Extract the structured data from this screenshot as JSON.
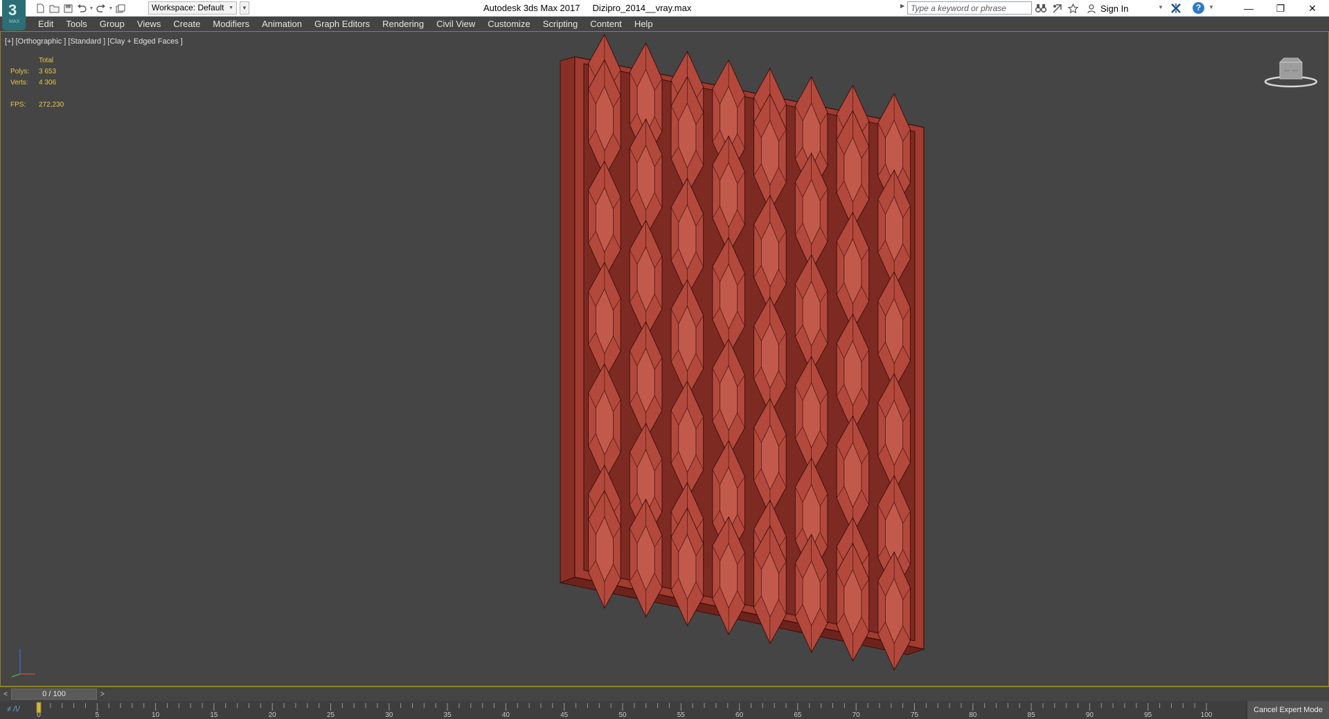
{
  "app": {
    "logo_text": "3",
    "logo_sub": "MAX",
    "title": "Autodesk 3ds Max 2017     Dizipro_2014__vray.max"
  },
  "quick_access": {
    "workspace_label": "Workspace: Default"
  },
  "search": {
    "placeholder": "Type a keyword or phrase"
  },
  "account": {
    "sign_in": "Sign In"
  },
  "window_controls": {
    "minimize": "—",
    "restore": "❐",
    "close": "✕"
  },
  "menu": {
    "items": [
      "Edit",
      "Tools",
      "Group",
      "Views",
      "Create",
      "Modifiers",
      "Animation",
      "Graph Editors",
      "Rendering",
      "Civil View",
      "Customize",
      "Scripting",
      "Content",
      "Help"
    ]
  },
  "viewport": {
    "label": "[+] [Orthographic ] [Standard ] [Clay + Edged Faces ]",
    "stats": {
      "header": "Total",
      "polys_label": "Polys:",
      "polys_value": "3 653",
      "verts_label": "Verts:",
      "verts_value": "4 306",
      "fps_label": "FPS:",
      "fps_value": "272,230"
    },
    "model": {
      "frame_color": "#a23b30",
      "tile_color": "#b2493c",
      "edge_color": "#3a0d0a",
      "columns": 8,
      "rows": 5
    }
  },
  "timeline": {
    "frame_display": "0 / 100",
    "left_arrow": "<",
    "right_arrow": ">",
    "current_frame": 0,
    "start": 0,
    "end": 100,
    "tick_labels": [
      "0",
      "5",
      "10",
      "15",
      "20",
      "25",
      "30",
      "35",
      "40",
      "45",
      "50",
      "55",
      "60",
      "65",
      "70",
      "75",
      "80",
      "85",
      "90",
      "95",
      "100"
    ]
  },
  "status": {
    "cancel_expert": "Cancel Expert Mode",
    "track_icon": "≠ /\\/"
  },
  "icons": {
    "new": "new-file-icon",
    "open": "open-folder-icon",
    "save": "save-icon",
    "undo": "undo-icon",
    "redo": "redo-icon",
    "project": "project-folder-icon",
    "binoculars": "binoculars-icon",
    "favorites": "star-icon",
    "communication": "communication-icon",
    "exchange": "autodesk-exchange-icon",
    "help": "help-icon"
  }
}
